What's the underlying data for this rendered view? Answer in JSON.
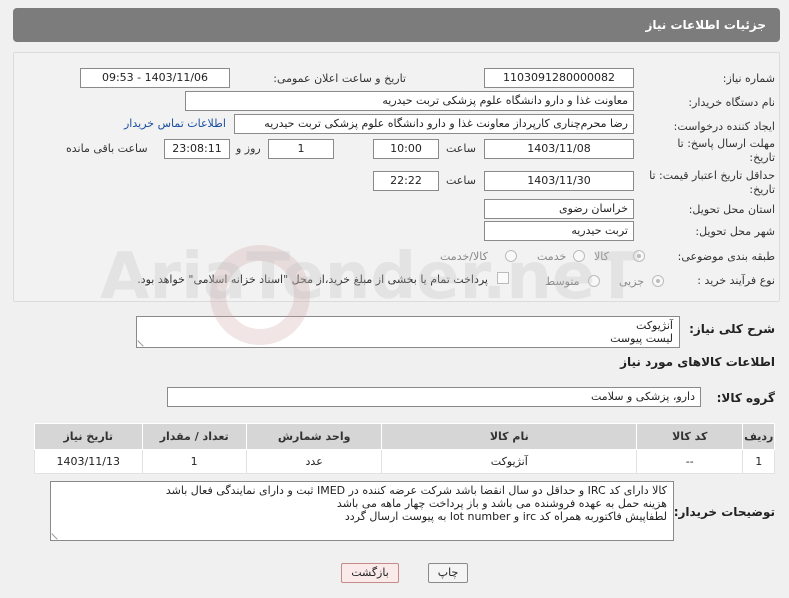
{
  "window": {
    "title": "جزئیات اطلاعات نیاز"
  },
  "colors": {
    "header": "#7c7c7c",
    "link": "#1a4fa0",
    "back_button_border": "#c58a8a"
  },
  "form": {
    "need_number": {
      "label": "شماره نیاز:",
      "value": "1103091280000082"
    },
    "announce_datetime": {
      "label": "تاریخ و ساعت اعلان عمومی:",
      "value": "1403/11/06 - 09:53"
    },
    "buyer_org": {
      "label": "نام دستگاه خریدار:",
      "value": "معاونت غذا و دارو   دانشگاه علوم پزشکی تربت حیدریه"
    },
    "requester": {
      "label": "ایجاد کننده درخواست:",
      "value": "رضا محرم‌چناری کارپرداز معاونت غذا و دارو   دانشگاه علوم پزشکی تربت حیدریه"
    },
    "contact_link": "اطلاعات تماس خریدار",
    "reply_deadline": {
      "label_line1": "مهلت ارسال پاسخ: تا",
      "label_line2": "تاریخ:",
      "date": "1403/11/08",
      "time_label": "ساعت",
      "time": "10:00",
      "days": "1",
      "days_label": "روز و",
      "remaining": "23:08:11",
      "remaining_label": "ساعت باقی مانده"
    },
    "price_validity": {
      "label_line1": "حداقل تاریخ اعتبار قیمت: تا",
      "label_line2": "تاریخ:",
      "date": "1403/11/30",
      "time_label": "ساعت",
      "time": "22:22"
    },
    "province": {
      "label": "استان محل تحویل:",
      "value": "خراسان رضوی"
    },
    "city": {
      "label": "شهر محل تحویل:",
      "value": "تربت حیدریه"
    },
    "category": {
      "label": "طبقه بندی موضوعی:",
      "options": [
        "کالا",
        "خدمت",
        "کالا/خدمت"
      ],
      "selected": "کالا"
    },
    "purchase_type": {
      "label": "نوع فرآیند خرید :",
      "options": [
        "جزیی",
        "متوسط"
      ],
      "selected": "جزیی",
      "payment_note": "پرداخت تمام یا بخشی از مبلغ خرید،از محل \"اسناد خزانه اسلامی\" خواهد بود."
    }
  },
  "overall_desc": {
    "label": "شرح کلی نیاز:",
    "lines": [
      "آنژیوکت",
      "لیست پیوست"
    ]
  },
  "goods_section": {
    "title": "اطلاعات کالاهای مورد نیاز",
    "group_label": "گروه کالا:",
    "group_value": "دارو، پزشکی و سلامت",
    "columns": [
      "ردیف",
      "کد کالا",
      "نام کالا",
      "واحد شمارش",
      "تعداد / مقدار",
      "تاریخ نیاز"
    ],
    "rows": [
      [
        "1",
        "--",
        "آنژیوکت",
        "عدد",
        "1",
        "1403/11/13"
      ]
    ]
  },
  "buyer_notes": {
    "label": "توضیحات خریدار:",
    "lines": [
      "کالا دارای کد IRC و حداقل دو سال انقضا باشد شرکت عرضه کننده در IMED ثبت و دارای نمایندگی فعال باشد",
      "هزینه حمل به عهده فروشنده می باشد و باز پرداخت چهار ماهه می باشد",
      "لطفاپیش فاکتوربه همراه کد irc و lot number به پیوست ارسال گردد"
    ]
  },
  "buttons": {
    "print": "چاپ",
    "back": "بازگشت"
  },
  "watermark": {
    "text": "AriaTender.neT"
  }
}
